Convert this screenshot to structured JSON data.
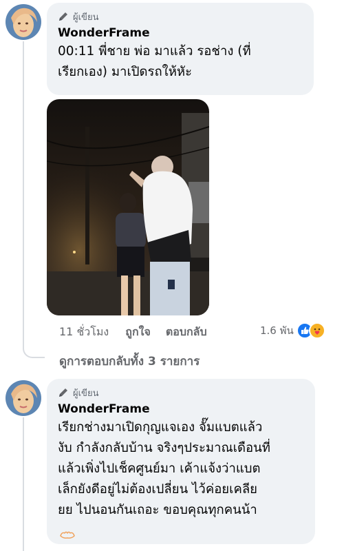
{
  "comments": [
    {
      "author_badge": "ผู้เขียน",
      "author": "WonderFrame",
      "text_lines": [
        "00:11 พี่ชาย พ่อ มาแล้ว รอช่าง (ที่",
        "เรียกเอง) มาเปิดรถให้หัะ"
      ]
    },
    {
      "author_badge": "ผู้เขียน",
      "author": "WonderFrame",
      "text_lines": [
        "เรียกช่างมาเปิดกุญแจเอง จั๊มแบตแล้ว",
        "งับ กำลังกลับบ้าน จริงๆประมาณเดือนที่",
        "แล้วเพิ่งไปเช็คศูนย์มา เค้าแจ้งว่าแบต",
        "เล็กยังดีอยู่ไม่ต้องเปลี่ยน ไว้ค่อยเคลีย",
        "ยย ไปนอนกันเถอะ ขอบคุณทุกคนน้า"
      ]
    }
  ],
  "actions": {
    "time": "11 ชั่วโมง",
    "like": "ถูกใจ",
    "reply": "ตอบกลับ"
  },
  "reactions": {
    "count": "1.6 พัน",
    "icons": [
      "like-reaction-icon",
      "care-reaction-icon"
    ]
  },
  "view_replies": "ดูการตอบกลับทั้ง 3 รายการ",
  "colors": {
    "bubble": "#eff2f5",
    "secondary_text": "#65676b",
    "like_blue": "#1877f2",
    "care_yellow": "#f7b125"
  }
}
